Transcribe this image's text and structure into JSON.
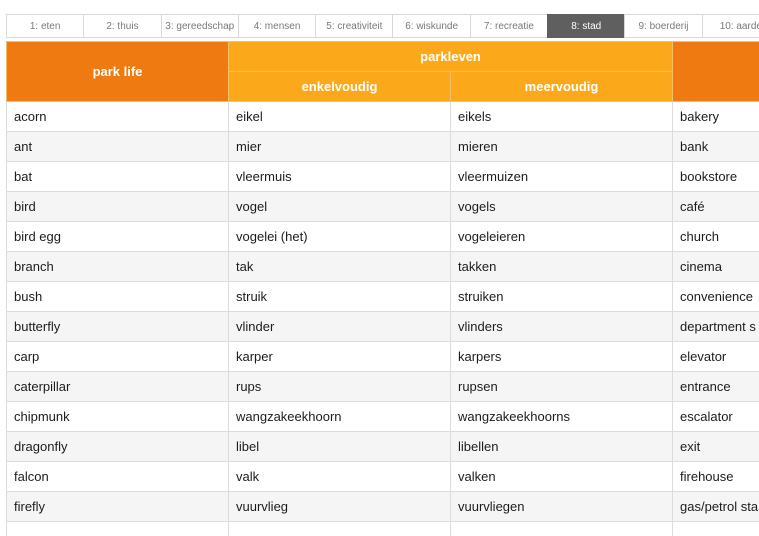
{
  "tabs": [
    {
      "label": "1: eten",
      "active": false
    },
    {
      "label": "2: thuis",
      "active": false
    },
    {
      "label": "3: gereedschap",
      "active": false
    },
    {
      "label": "4: mensen",
      "active": false
    },
    {
      "label": "5: creativiteit",
      "active": false
    },
    {
      "label": "6: wiskunde",
      "active": false
    },
    {
      "label": "7: recreatie",
      "active": false
    },
    {
      "label": "8: stad",
      "active": true
    },
    {
      "label": "9: boerderij",
      "active": false
    },
    {
      "label": "10: aarde",
      "active": false
    }
  ],
  "table": {
    "col1_header": "park life",
    "group_header": "parkleven",
    "sub_header_1": "enkelvoudig",
    "sub_header_2": "meervoudig",
    "col4_header": "",
    "rows": [
      [
        "acorn",
        "eikel",
        "eikels",
        "bakery"
      ],
      [
        "ant",
        "mier",
        "mieren",
        "bank"
      ],
      [
        "bat",
        "vleermuis",
        "vleermuizen",
        "bookstore"
      ],
      [
        "bird",
        "vogel",
        "vogels",
        "café"
      ],
      [
        "bird egg",
        "vogelei (het)",
        "vogeleieren",
        "church"
      ],
      [
        "branch",
        "tak",
        "takken",
        "cinema"
      ],
      [
        "bush",
        "struik",
        "struiken",
        "convenience"
      ],
      [
        "butterfly",
        "vlinder",
        "vlinders",
        "department s"
      ],
      [
        "carp",
        "karper",
        "karpers",
        "elevator"
      ],
      [
        "caterpillar",
        "rups",
        "rupsen",
        "entrance"
      ],
      [
        "chipmunk",
        "wangzakeekhoorn",
        "wangzakeekhoorns",
        "escalator"
      ],
      [
        "dragonfly",
        "libel",
        "libellen",
        "exit"
      ],
      [
        "falcon",
        "valk",
        "valken",
        "firehouse"
      ],
      [
        "firefly",
        "vuurvlieg",
        "vuurvliegen",
        "gas/petrol sta"
      ],
      [
        "",
        "",
        "",
        ""
      ]
    ]
  },
  "colors": {
    "header_dark": "#ef7a12",
    "header_light": "#fba81a",
    "active_tab": "#5f5f5f"
  }
}
